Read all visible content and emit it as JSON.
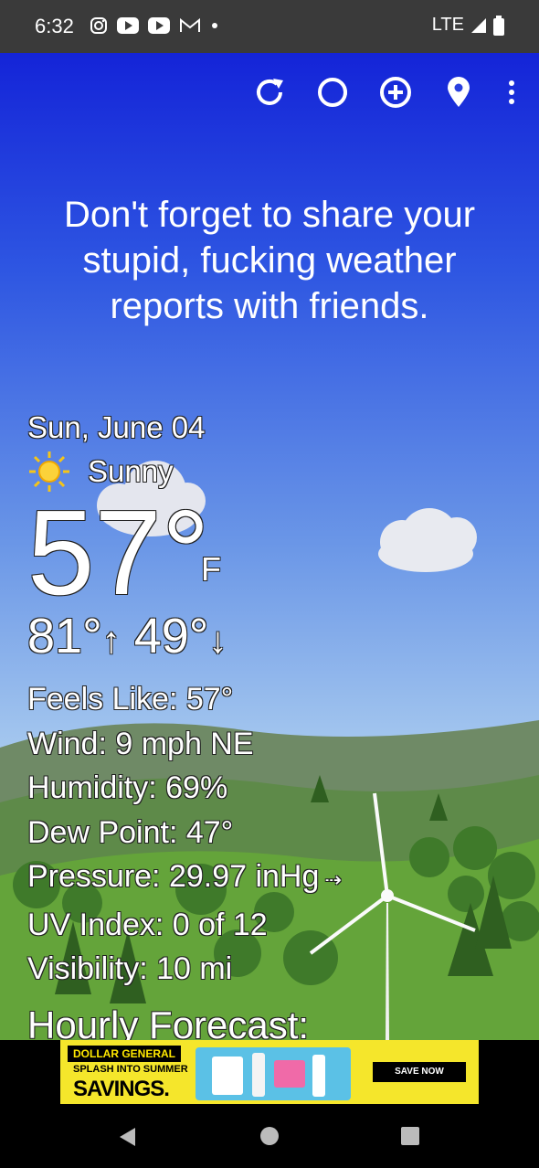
{
  "status_bar": {
    "time": "6:32",
    "network": "LTE",
    "notification_icons": [
      "instagram-icon",
      "youtube-icon",
      "youtube-icon",
      "gmail-icon",
      "dot-icon"
    ]
  },
  "toolbar": {
    "icons": [
      "refresh-icon",
      "theme-icon",
      "add-location-icon",
      "location-pin-icon",
      "overflow-menu-icon"
    ]
  },
  "headline": "Don't forget to share your stupid, fucking weather reports with friends.",
  "weather": {
    "date": "Sun, June 04",
    "condition": "Sunny",
    "condition_icon": "sun-icon",
    "temperature": "57°",
    "unit": "F",
    "high": "81°",
    "low": "49°",
    "feels_like": "Feels Like:  57°",
    "wind": "Wind:  9 mph NE",
    "humidity": "Humidity:  69%",
    "dew_point": "Dew Point:  47°",
    "pressure": "Pressure:  29.97 inHg",
    "uv_index": "UV Index:  0 of 12",
    "visibility": "Visibility:  10 mi"
  },
  "hourly_heading": "Hourly Forecast:",
  "ad": {
    "brand": "DOLLAR GENERAL",
    "line1": "SPLASH INTO SUMMER",
    "line2": "SAVINGS.",
    "cta": "SAVE NOW"
  },
  "colors": {
    "sky_top": "#1424d8",
    "sky_bottom": "#c8def2",
    "hills": "#5f9a3a",
    "ad_yellow": "#f5e62b"
  }
}
